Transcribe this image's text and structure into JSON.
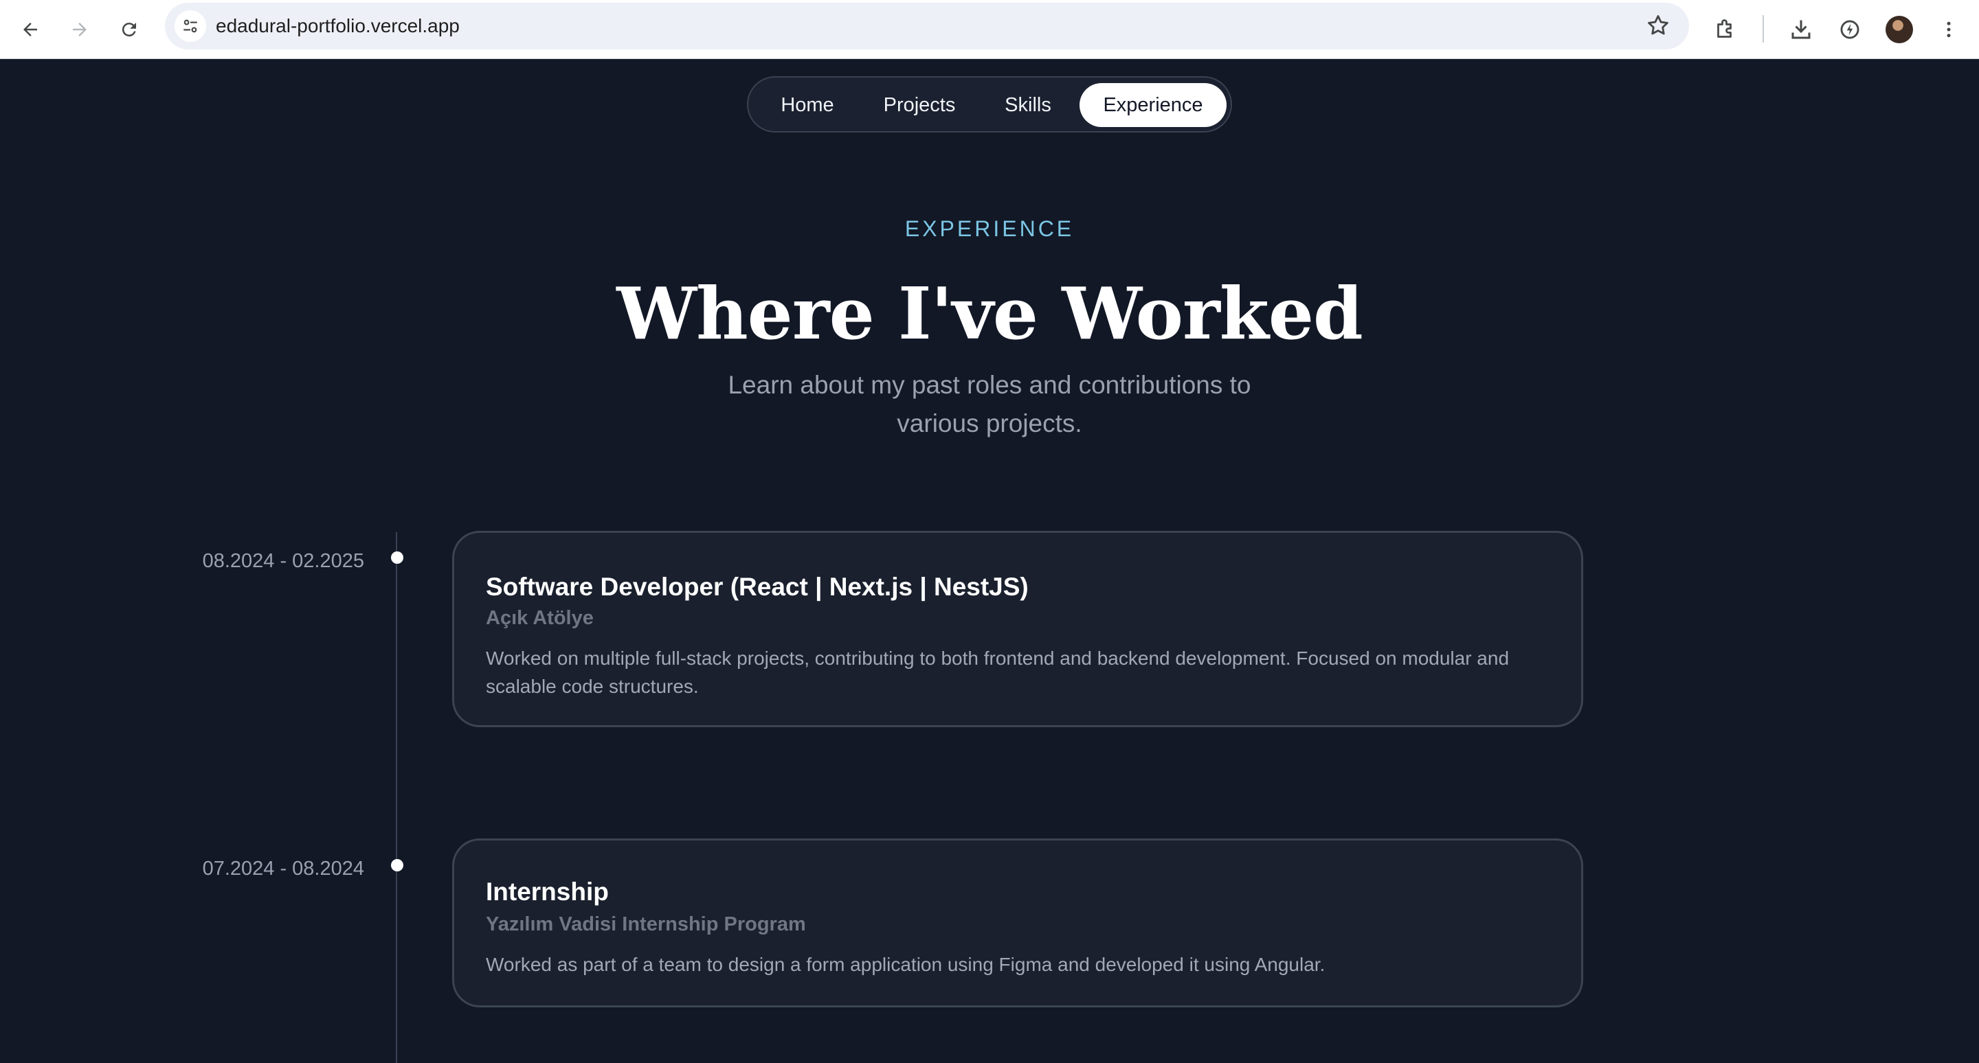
{
  "browser": {
    "url": "edadural-portfolio.vercel.app",
    "icons": [
      "back-icon",
      "forward-icon",
      "reload-icon",
      "site-settings-icon",
      "bookmark-star-icon",
      "extensions-icon",
      "download-icon",
      "performance-icon",
      "profile-avatar",
      "menu-kebab-icon"
    ]
  },
  "nav": {
    "items": [
      {
        "label": "Home"
      },
      {
        "label": "Projects"
      },
      {
        "label": "Skills"
      },
      {
        "label": "Experience"
      }
    ],
    "active": "Experience"
  },
  "section": {
    "eyebrow": "EXPERIENCE",
    "title": "Where I've Worked",
    "subtitle": "Learn about my past roles and contributions to various projects."
  },
  "experience": [
    {
      "date": "08.2024 - 02.2025",
      "title": "Software Developer (React | Next.js | NestJS)",
      "company": "Açık Atölye",
      "description": "Worked on multiple full-stack projects, contributing to both frontend and backend development. Focused on modular and scalable code structures."
    },
    {
      "date": "07.2024 - 08.2024",
      "title": "Internship",
      "company": "Yazılım Vadisi Internship Program",
      "description": "Worked as part of a team to design a form application using Figma and developed it using Angular."
    }
  ],
  "colors": {
    "background": "#121826",
    "card": "#1a202d",
    "accent": "#7cc6e4",
    "muted": "#9aa1b0"
  }
}
